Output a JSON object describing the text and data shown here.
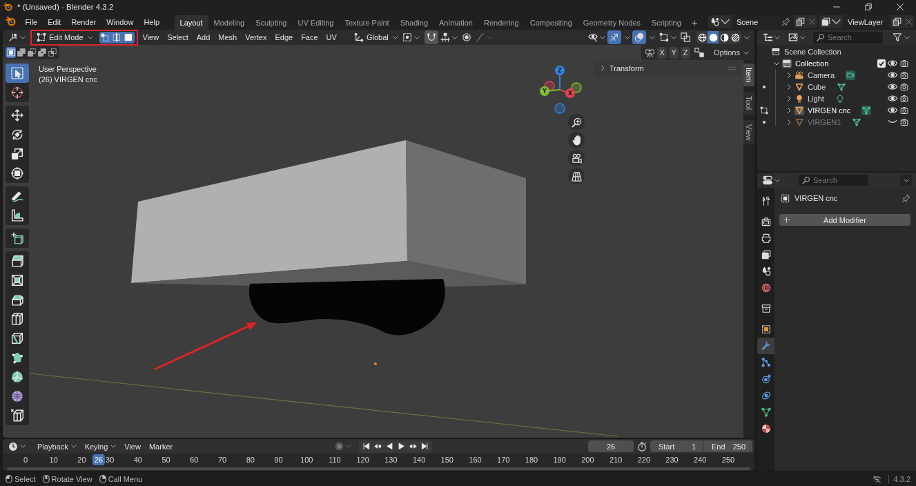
{
  "window": {
    "title": "* (Unsaved) - Blender 4.3.2"
  },
  "menu": [
    "File",
    "Edit",
    "Render",
    "Window",
    "Help"
  ],
  "workspaces": [
    {
      "label": "Layout",
      "selected": true
    },
    {
      "label": "Modeling",
      "selected": false
    },
    {
      "label": "Sculpting",
      "selected": false
    },
    {
      "label": "UV Editing",
      "selected": false
    },
    {
      "label": "Texture Paint",
      "selected": false
    },
    {
      "label": "Shading",
      "selected": false
    },
    {
      "label": "Animation",
      "selected": false
    },
    {
      "label": "Rendering",
      "selected": false
    },
    {
      "label": "Compositing",
      "selected": false
    },
    {
      "label": "Geometry Nodes",
      "selected": false
    },
    {
      "label": "Scripting",
      "selected": false
    }
  ],
  "add_workspace": "+",
  "scene": {
    "name": "Scene"
  },
  "view_layer": {
    "name": "ViewLayer"
  },
  "viewport": {
    "mode": "Edit Mode",
    "select_modes": [
      {
        "kind": "vertex",
        "selected": true
      },
      {
        "kind": "edge",
        "selected": true
      },
      {
        "kind": "face",
        "selected": true
      }
    ],
    "menus": [
      "View",
      "Select",
      "Add",
      "Mesh",
      "Vertex",
      "Edge",
      "Face",
      "UV"
    ],
    "orientation": "Global",
    "show_gizmos": true,
    "show_overlays": true,
    "shading": [
      {
        "kind": "wireframe",
        "selected": false
      },
      {
        "kind": "solid",
        "selected": true
      },
      {
        "kind": "material",
        "selected": false
      },
      {
        "kind": "rendered",
        "selected": false
      }
    ],
    "box_select_modes": [
      {
        "kind": "set",
        "selected": true
      },
      {
        "kind": "extend",
        "selected": false
      },
      {
        "kind": "subtract",
        "selected": false
      },
      {
        "kind": "invert",
        "selected": false
      },
      {
        "kind": "intersect",
        "selected": false
      }
    ],
    "mirror_axes": [
      {
        "label": "X",
        "selected": false
      },
      {
        "label": "Y",
        "selected": false
      },
      {
        "label": "Z",
        "selected": false
      }
    ],
    "options": "Options",
    "info": [
      "User Perspective",
      "(26) VIRGEN cnc"
    ],
    "tool_groups": [
      {
        "tools": [
          {
            "kind": "select_box",
            "selected": true
          },
          {
            "kind": "cursor",
            "selected": false
          }
        ]
      },
      {
        "tools": [
          {
            "kind": "move",
            "selected": false
          },
          {
            "kind": "rotate",
            "selected": false
          },
          {
            "kind": "scale",
            "selected": false
          },
          {
            "kind": "transform",
            "selected": false
          }
        ]
      },
      {
        "tools": [
          {
            "kind": "annotate",
            "selected": false
          },
          {
            "kind": "measure",
            "selected": false
          }
        ]
      },
      {
        "tools": [
          {
            "kind": "add_cube",
            "selected": false
          }
        ]
      },
      {
        "tools": [
          {
            "kind": "extrude",
            "selected": false
          },
          {
            "kind": "inset",
            "selected": false
          },
          {
            "kind": "bevel",
            "selected": false
          },
          {
            "kind": "loop_cut",
            "selected": false
          },
          {
            "kind": "knife",
            "selected": false
          },
          {
            "kind": "poly_build",
            "selected": false
          },
          {
            "kind": "spin",
            "selected": false
          },
          {
            "kind": "smooth",
            "selected": false
          },
          {
            "kind": "edge_slide",
            "selected": false
          }
        ]
      }
    ],
    "gizmo_axes": [
      {
        "label": "Z",
        "color": "#2f83e0"
      },
      {
        "label": "Y",
        "color": "#80bd2c"
      },
      {
        "label": "X",
        "color": "#e0434f"
      }
    ],
    "sidebar": {
      "panels": [
        {
          "label": "Transform",
          "expanded": false
        }
      ],
      "tabs": [
        {
          "label": "Item",
          "selected": true
        },
        {
          "label": "Tool",
          "selected": false
        },
        {
          "label": "View",
          "selected": false
        }
      ]
    }
  },
  "outliner": {
    "search": {
      "placeholder": "Search"
    },
    "tree": [
      {
        "label": "Scene Collection",
        "kind": "scene_collection",
        "active": false,
        "children": [
          {
            "label": "Collection",
            "kind": "collection",
            "active": true,
            "expanded": true,
            "checked": true,
            "visible": true,
            "children": [
              {
                "label": "Camera",
                "kind": "camera",
                "active": false,
                "expanded": false,
                "visible": true,
                "data": {
                  "kind": "camera",
                  "highlighted": true
                }
              },
              {
                "label": "Cube",
                "kind": "mesh",
                "active": false,
                "expanded": false,
                "visible": true,
                "in_edit_mode": false,
                "data": {
                  "kind": "mesh",
                  "highlighted": false
                }
              },
              {
                "label": "Light",
                "kind": "light",
                "active": false,
                "expanded": false,
                "visible": true,
                "data": {
                  "kind": "light",
                  "highlighted": false
                }
              },
              {
                "label": "VIRGEN cnc",
                "kind": "mesh",
                "active": true,
                "expanded": false,
                "visible": true,
                "in_edit_mode": true,
                "data": {
                  "kind": "mesh",
                  "highlighted": true
                }
              },
              {
                "label": "VIRGEN1",
                "kind": "mesh",
                "active": false,
                "expanded": false,
                "visible": false,
                "in_edit_mode": false,
                "data": {
                  "kind": "mesh",
                  "highlighted": false
                }
              }
            ]
          }
        ]
      }
    ]
  },
  "properties": {
    "search": {
      "placeholder": "Search"
    },
    "tab_groups": [
      {
        "tabs": [
          {
            "kind": "tool",
            "selected": false
          }
        ]
      },
      {
        "tabs": [
          {
            "kind": "render",
            "selected": false
          },
          {
            "kind": "output",
            "selected": false
          },
          {
            "kind": "view_layer",
            "selected": false
          },
          {
            "kind": "scene",
            "selected": false
          },
          {
            "kind": "world",
            "selected": false
          }
        ]
      },
      {
        "tabs": [
          {
            "kind": "collection",
            "selected": false
          }
        ]
      },
      {
        "tabs": [
          {
            "kind": "object",
            "selected": false
          },
          {
            "kind": "modifiers",
            "selected": true
          },
          {
            "kind": "particles",
            "selected": false
          },
          {
            "kind": "physics",
            "selected": false
          },
          {
            "kind": "constraints",
            "selected": false
          },
          {
            "kind": "data",
            "selected": false
          },
          {
            "kind": "material",
            "selected": false
          }
        ]
      }
    ],
    "object_name": "VIRGEN cnc",
    "add_modifier": "Add Modifier"
  },
  "timeline": {
    "menus": [
      {
        "label": "Playback",
        "dropdown": true
      },
      {
        "label": "Keying",
        "dropdown": true
      },
      {
        "label": "View",
        "dropdown": false
      },
      {
        "label": "Marker",
        "dropdown": false
      }
    ],
    "current_frame": "26",
    "start": {
      "label": "Start",
      "value": "1"
    },
    "end": {
      "label": "End",
      "value": "250"
    },
    "ruler": [
      "0",
      "10",
      "20",
      "30",
      "40",
      "50",
      "60",
      "70",
      "80",
      "90",
      "100",
      "110",
      "120",
      "130",
      "140",
      "150",
      "160",
      "170",
      "180",
      "190",
      "200",
      "210",
      "220",
      "230",
      "240",
      "250"
    ],
    "playhead": {
      "label": "26",
      "level": 0.104
    }
  },
  "status_bar": {
    "hints": [
      {
        "kind": "mouse_left",
        "label": "Select"
      },
      {
        "kind": "mouse_middle",
        "label": "Rotate View"
      },
      {
        "kind": "mouse_right",
        "label": "Call Menu"
      }
    ],
    "version": "4.3.2"
  }
}
